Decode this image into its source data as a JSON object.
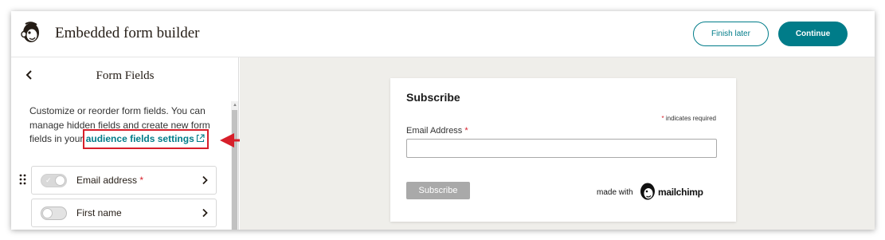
{
  "header": {
    "title": "Embedded form builder",
    "finish_later_label": "Finish later",
    "continue_label": "Continue",
    "logo_icon": "mailchimp-freddie-icon"
  },
  "sidebar": {
    "back_icon": "chevron-left-icon",
    "title": "Form Fields",
    "description": "Customize or reorder form fields. You can manage hidden fields and create new form fields in your",
    "link_label": "audience fields settings",
    "link_icon": "external-link-icon",
    "fields": [
      {
        "label": "Email address",
        "required_mark": "*",
        "toggle": "on-disabled"
      },
      {
        "label": "First name",
        "required_mark": "",
        "toggle": "off"
      }
    ]
  },
  "annotation": {
    "highlight_color": "#d71f2a",
    "arrow_color": "#d71f2a"
  },
  "preview": {
    "form_title": "Subscribe",
    "required_star": "*",
    "required_note": " indicates required",
    "email_label": "Email Address",
    "email_required_mark": "*",
    "email_value": "",
    "subscribe_label": "Subscribe",
    "made_with": "made with",
    "brand_name": "mailchimp"
  },
  "colors": {
    "accent": "#007c89",
    "preview_background": "#efeeea",
    "disabled_button": "#a9a9a9"
  }
}
